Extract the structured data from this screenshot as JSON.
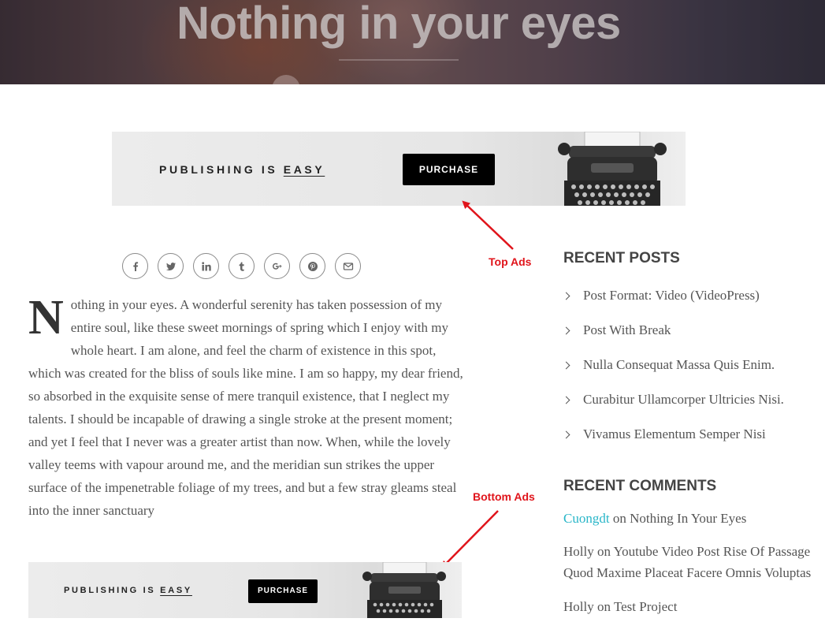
{
  "hero": {
    "title": "Nothing in your eyes"
  },
  "ads": {
    "top": {
      "text_prefix": "PUBLISHING IS ",
      "text_emph": "EASY",
      "button_label": "PURCHASE"
    },
    "bottom": {
      "text_prefix": "PUBLISHING IS ",
      "text_emph": "EASY",
      "button_label": "PURCHASE"
    }
  },
  "annotations": {
    "top": "Top Ads",
    "bottom": "Bottom Ads",
    "color": "#e0141b"
  },
  "share": {
    "icons": [
      "facebook-icon",
      "twitter-icon",
      "linkedin-icon",
      "tumblr-icon",
      "google-plus-icon",
      "pinterest-icon",
      "email-icon"
    ]
  },
  "article": {
    "dropcap": "N",
    "body": "othing in your eyes. A wonderful serenity has taken possession of my entire soul, like these sweet mornings of spring which I enjoy with my whole heart. I am alone, and feel the charm of existence in this spot, which was created for the bliss of souls like mine. I am so happy, my dear friend, so absorbed in the exquisite sense of mere tranquil existence, that I neglect my talents. I should be incapable of drawing a single stroke at the present moment; and yet I feel that I never was a greater artist than now. When, while the lovely valley teems with vapour around me, and the meridian sun strikes the upper surface of the impenetrable foliage of my trees, and but a few stray gleams steal into the inner sanctuary"
  },
  "sidebar": {
    "recent_posts": {
      "title": "RECENT POSTS",
      "items": [
        "Post Format: Video (VideoPress)",
        "Post With Break",
        "Nulla Consequat Massa Quis Enim.",
        "Curabitur Ullamcorper Ultricies Nisi.",
        "Vivamus Elementum Semper Nisi"
      ]
    },
    "recent_comments": {
      "title": "RECENT COMMENTS",
      "on_word": "on",
      "items": [
        {
          "author": "Cuongdt",
          "post": "Nothing In Your Eyes"
        },
        {
          "author": "Holly",
          "post": "Youtube Video Post Rise Of Passage Quod Maxime Placeat Facere Omnis Voluptas"
        },
        {
          "author": "Holly",
          "post": "Test Project"
        }
      ]
    }
  },
  "colors": {
    "link": "#29b6c8",
    "text": "#555555",
    "heading": "#444444",
    "annotation": "#e0141b"
  }
}
